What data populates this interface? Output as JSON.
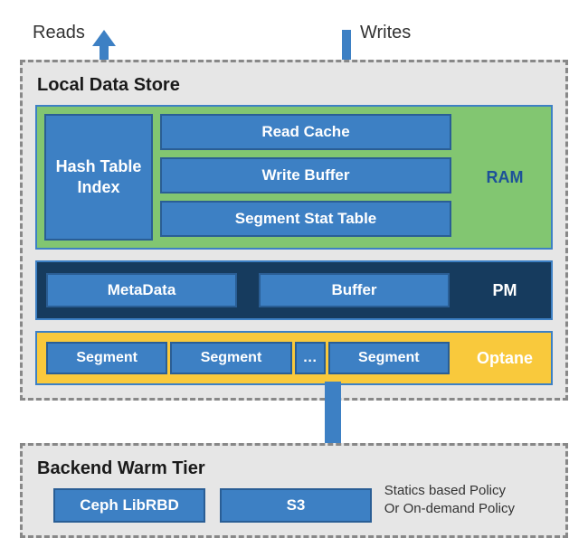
{
  "top": {
    "reads_label": "Reads",
    "writes_label": "Writes"
  },
  "local_store": {
    "title": "Local Data Store",
    "ram": {
      "label": "RAM",
      "hash_table": "Hash Table Index",
      "read_cache": "Read Cache",
      "write_buffer": "Write Buffer",
      "segment_stat": "Segment Stat Table"
    },
    "pm": {
      "label": "PM",
      "metadata": "MetaData",
      "buffer": "Buffer"
    },
    "optane": {
      "label": "Optane",
      "segment": "Segment",
      "dots": "…"
    }
  },
  "warm_tier": {
    "title": "Backend Warm Tier",
    "ceph": "Ceph LibRBD",
    "s3": "S3",
    "policy_line1": "Statics based Policy",
    "policy_line2": "Or On-demand Policy"
  }
}
